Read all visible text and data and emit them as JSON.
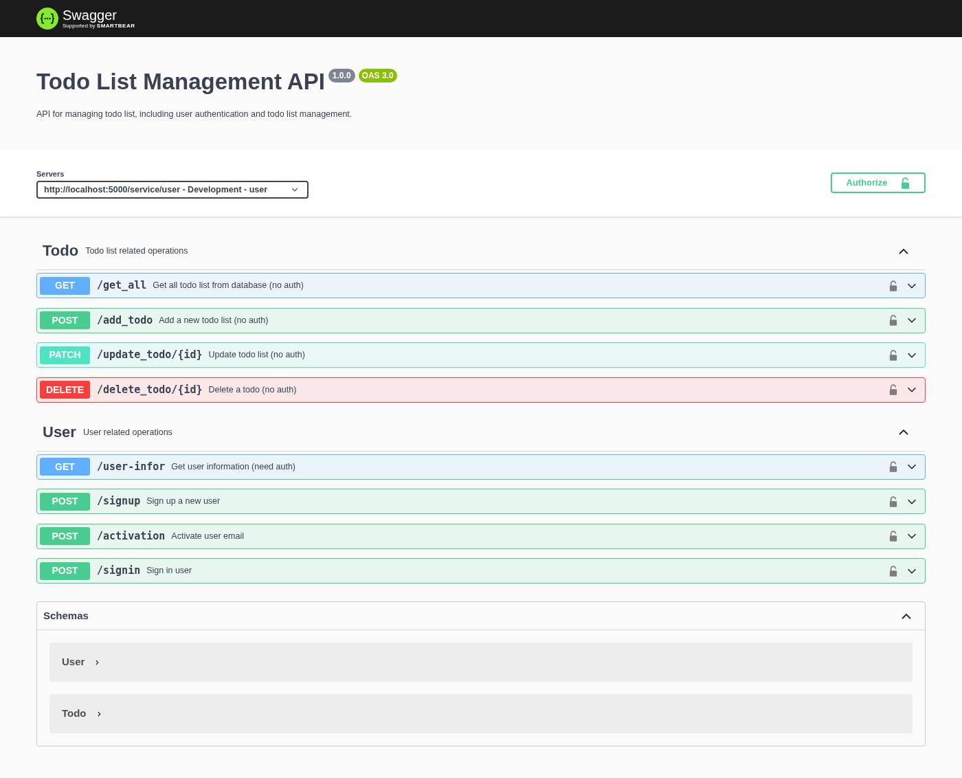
{
  "header": {
    "logo_name": "Swagger",
    "logo_tagline_prefix": "Supported by",
    "logo_tagline_brand": "SMARTBEAR"
  },
  "info": {
    "title": "Todo List Management API",
    "version": "1.0.0",
    "oas": "OAS 3.0",
    "description": "API for managing todo list, including user authentication and todo list management."
  },
  "servers": {
    "label": "Servers",
    "value": "http://localhost:5000/service/user - Development - user"
  },
  "authorize_button": "Authorize",
  "tags": [
    {
      "name": "Todo",
      "description": "Todo list related operations",
      "expanded": true,
      "operations": [
        {
          "kind": "get",
          "method": "GET",
          "path": "/get_all",
          "summary": "Get all todo list from database (no auth)"
        },
        {
          "kind": "post",
          "method": "POST",
          "path": "/add_todo",
          "summary": "Add a new todo list (no auth)"
        },
        {
          "kind": "patch",
          "method": "PATCH",
          "path": "/update_todo/{id}",
          "summary": "Update todo list (no auth)"
        },
        {
          "kind": "delete",
          "method": "DELETE",
          "path": "/delete_todo/{id}",
          "summary": "Delete a todo (no auth)"
        }
      ]
    },
    {
      "name": "User",
      "description": "User related operations",
      "expanded": true,
      "operations": [
        {
          "kind": "get",
          "method": "GET",
          "path": "/user-infor",
          "summary": "Get user information (need auth)"
        },
        {
          "kind": "post",
          "method": "POST",
          "path": "/signup",
          "summary": "Sign up a new user"
        },
        {
          "kind": "post",
          "method": "POST",
          "path": "/activation",
          "summary": "Activate user email"
        },
        {
          "kind": "post",
          "method": "POST",
          "path": "/signin",
          "summary": "Sign in user"
        }
      ]
    }
  ],
  "schemas": {
    "title": "Schemas",
    "expanded": true,
    "items": [
      {
        "name": "User",
        "expanded": false
      },
      {
        "name": "Todo",
        "expanded": false
      }
    ]
  }
}
